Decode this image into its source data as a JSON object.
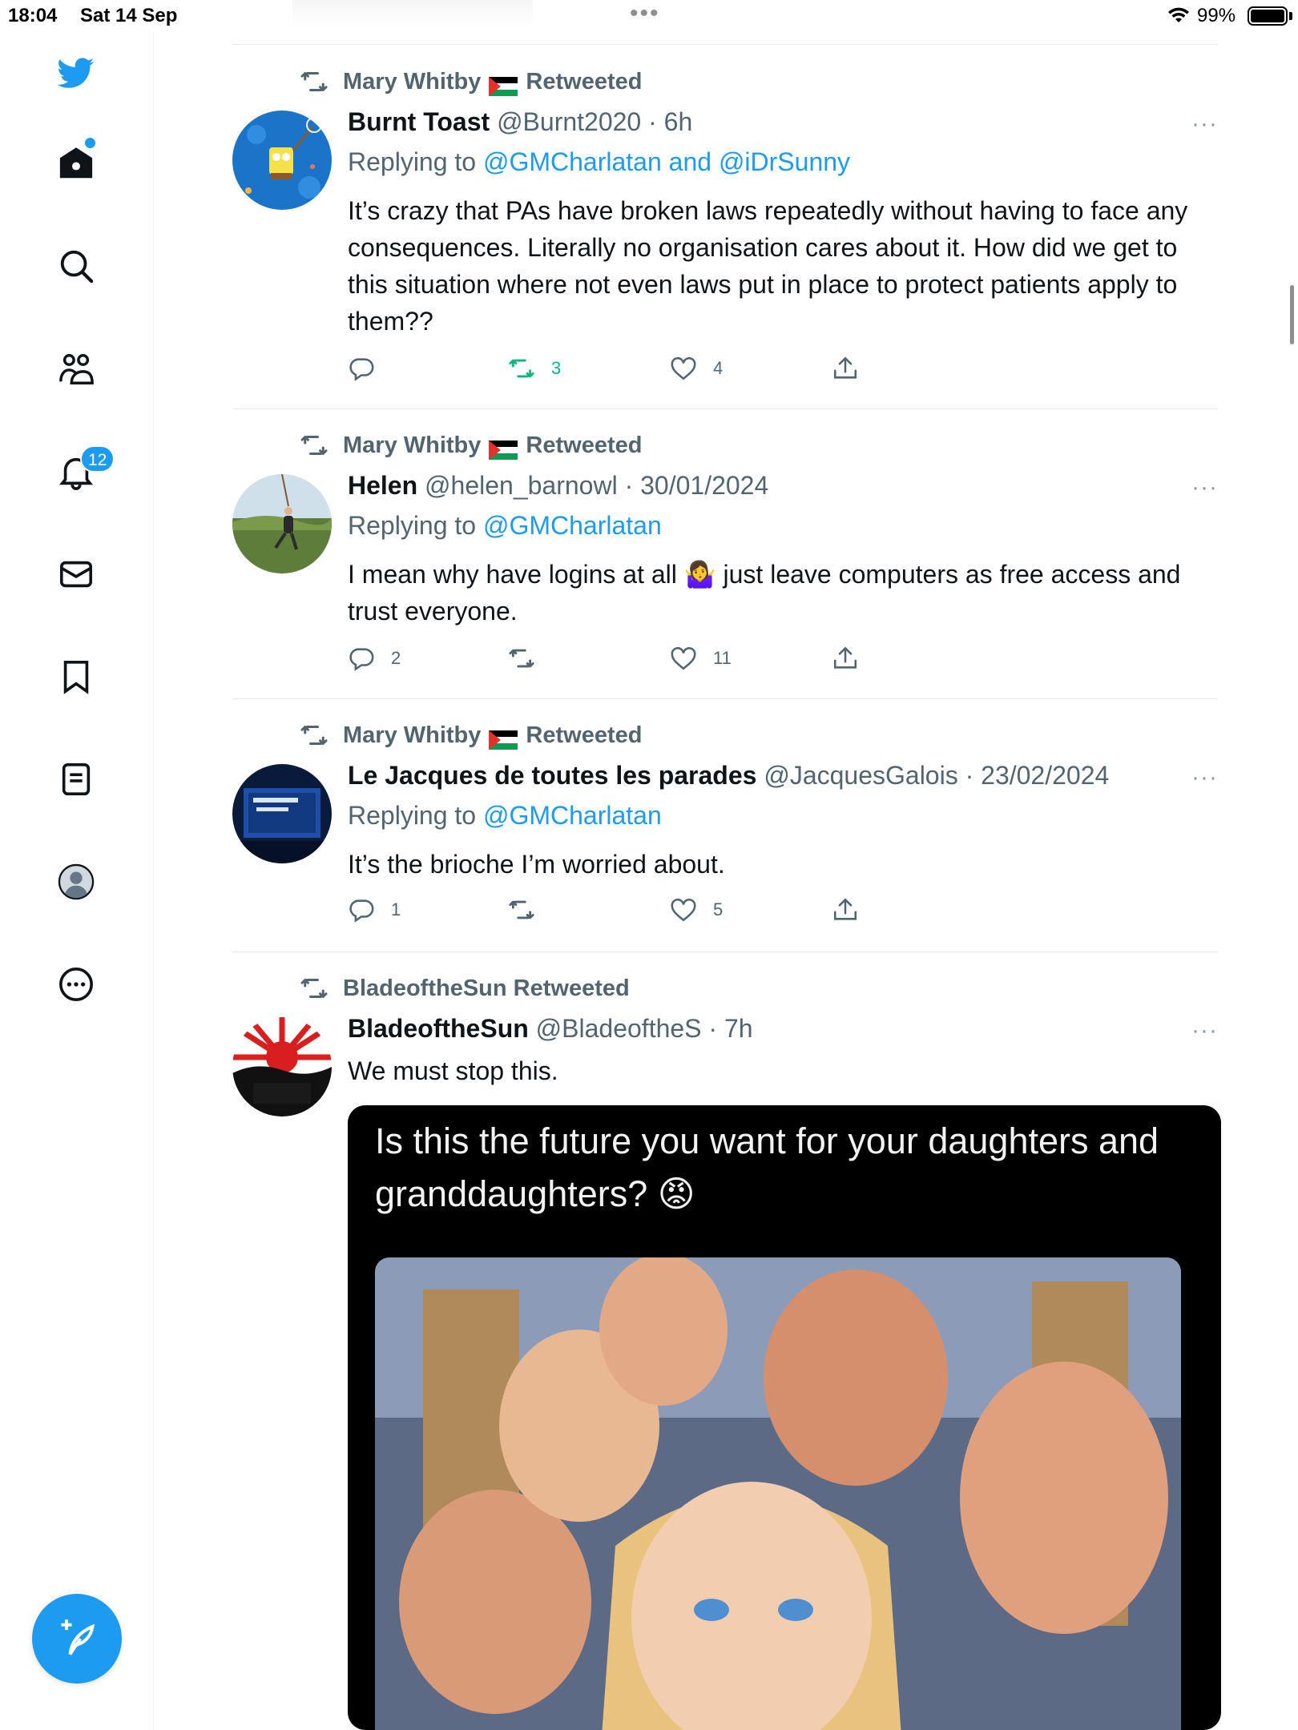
{
  "status_bar": {
    "time": "18:04",
    "date": "Sat 14 Sep",
    "battery": "99%"
  },
  "sidebar": {
    "items": [
      {
        "name": "twitter-logo-icon"
      },
      {
        "name": "home-icon"
      },
      {
        "name": "search-icon"
      },
      {
        "name": "communities-icon"
      },
      {
        "name": "notifications-icon",
        "badge": "12"
      },
      {
        "name": "messages-icon"
      },
      {
        "name": "bookmarks-icon"
      },
      {
        "name": "lists-icon"
      },
      {
        "name": "profile-icon"
      },
      {
        "name": "more-icon"
      }
    ],
    "notifications_badge": "12"
  },
  "tweets": [
    {
      "retweeted_by": "Mary Whitby",
      "retweeted_suffix": "Retweeted",
      "name": "Burnt Toast",
      "handle_time": "@Burnt2020 · 6h",
      "replying_prefix": "Replying to",
      "replying_to": "@GMCharlatan and @iDrSunny",
      "text": "It’s crazy that PAs have broken laws repeatedly without having to face any consequences. Literally no organisation cares about it. How did we get to this situation where not even laws put in place to protect patients apply to them??",
      "replies": "",
      "retweets": "3",
      "likes": "4",
      "retweeted": true
    },
    {
      "retweeted_by": "Mary Whitby",
      "retweeted_suffix": "Retweeted",
      "name": "Helen",
      "handle_time": "@helen_barnowl · 30/01/2024",
      "replying_prefix": "Replying to",
      "replying_to": "@GMCharlatan",
      "text_before_emoji": "I mean why have logins at all",
      "emoji": "🤷‍♀️",
      "text_after_emoji": "just leave computers as free access and trust everyone.",
      "replies": "2",
      "retweets": "",
      "likes": "11"
    },
    {
      "retweeted_by": "Mary Whitby",
      "retweeted_suffix": "Retweeted",
      "name": "Le Jacques de toutes les parades",
      "handle_time": "@JacquesGalois · 23/02/2024",
      "replying_prefix": "Replying to",
      "replying_to": "@GMCharlatan",
      "text": "It’s the brioche I’m worried about.",
      "replies": "1",
      "retweets": "",
      "likes": "5"
    },
    {
      "retweeted_line": "BladeoftheSun Retweeted",
      "name": "BladeoftheSun",
      "handle_time": "@BladeoftheS · 7h",
      "text": "We must stop this.",
      "media_caption": "Is this the future you want for your daughters and granddaughters? 😡"
    }
  ],
  "more_glyph": "···",
  "colors": {
    "accent": "#1d9bf0",
    "retweet_green": "#00ba7c",
    "secondary_text": "#536471"
  }
}
